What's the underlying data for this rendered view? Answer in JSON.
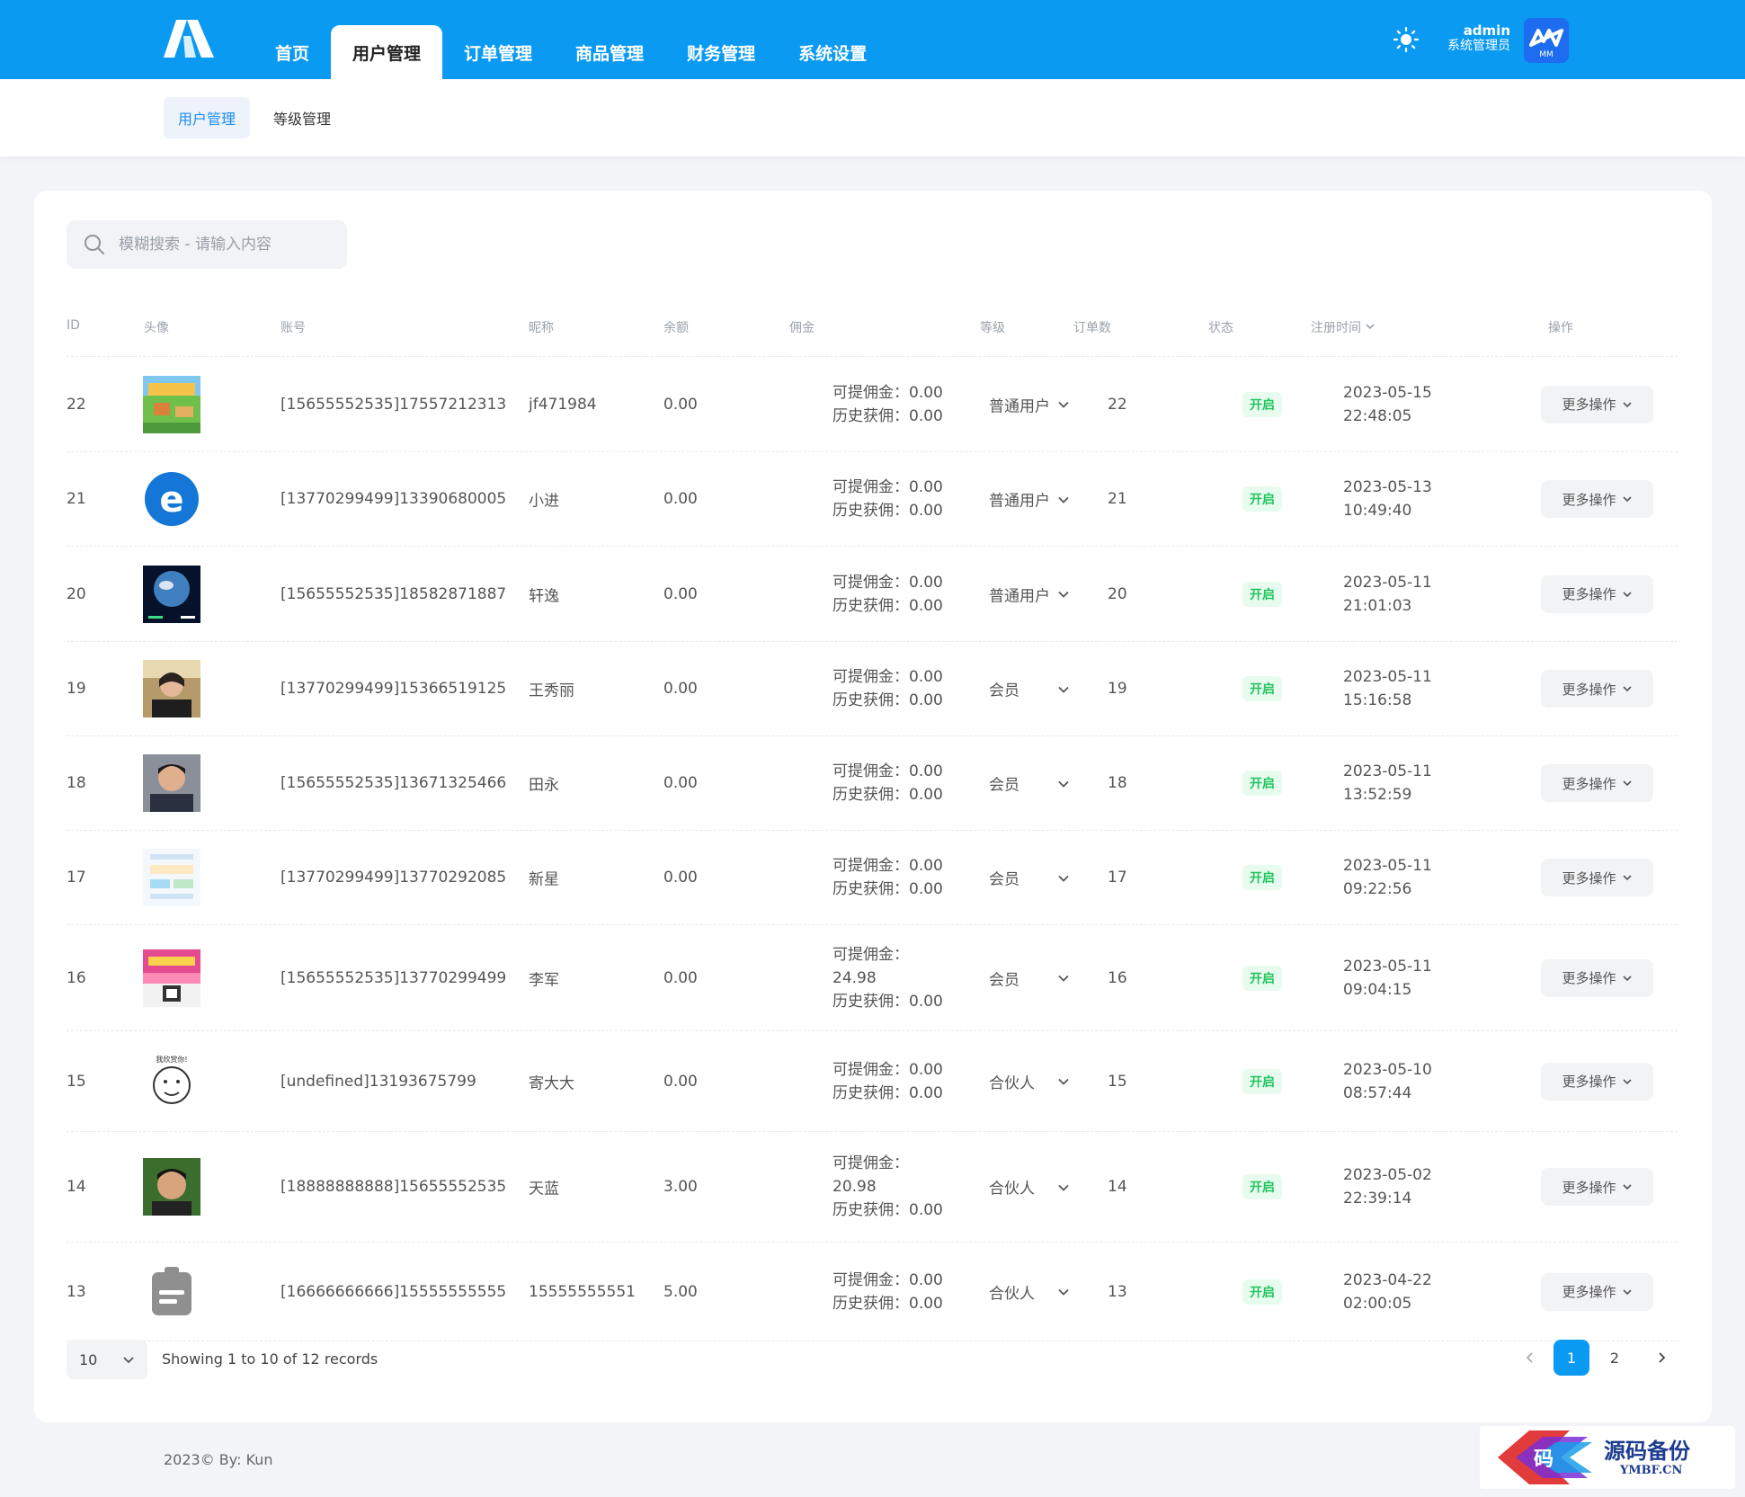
{
  "brand": {
    "accent": "#0b9af2",
    "avatar_label": "MM"
  },
  "nav": [
    {
      "label": "首页",
      "active": false
    },
    {
      "label": "用户管理",
      "active": true
    },
    {
      "label": "订单管理",
      "active": false
    },
    {
      "label": "商品管理",
      "active": false
    },
    {
      "label": "财务管理",
      "active": false
    },
    {
      "label": "系统设置",
      "active": false
    }
  ],
  "user": {
    "name": "admin",
    "role": "系统管理员"
  },
  "subnav": [
    {
      "label": "用户管理",
      "active": true
    },
    {
      "label": "等级管理",
      "active": false
    }
  ],
  "search": {
    "placeholder": "模糊搜索 - 请输入内容",
    "value": ""
  },
  "columns": [
    "ID",
    "头像",
    "账号",
    "昵称",
    "余额",
    "佣金",
    "等级",
    "订单数",
    "状态",
    "注册时间",
    "操作"
  ],
  "rows": [
    {
      "id": "22",
      "avatar": "game-thumbnail",
      "account": "[15655552535]17557212313",
      "nickname": "jf471984",
      "balance": "0.00",
      "commission_lines": [
        "可提佣金：0.00",
        "历史获佣：0.00"
      ],
      "level": "普通用户",
      "orders": "22",
      "status": "开启",
      "reg_date": "2023-05-15",
      "reg_time": "22:48:05",
      "action": "更多操作"
    },
    {
      "id": "21",
      "avatar": "telecom-logo",
      "account": "[13770299499]13390680005",
      "nickname": "小进",
      "balance": "0.00",
      "commission_lines": [
        "可提佣金：0.00",
        "历史获佣：0.00"
      ],
      "level": "普通用户",
      "orders": "21",
      "status": "开启",
      "reg_date": "2023-05-13",
      "reg_time": "10:49:40",
      "action": "更多操作"
    },
    {
      "id": "20",
      "avatar": "earth-photo",
      "account": "[15655552535]18582871887",
      "nickname": "轩逸",
      "balance": "0.00",
      "commission_lines": [
        "可提佣金：0.00",
        "历史获佣：0.00"
      ],
      "level": "普通用户",
      "orders": "20",
      "status": "开启",
      "reg_date": "2023-05-11",
      "reg_time": "21:01:03",
      "action": "更多操作"
    },
    {
      "id": "19",
      "avatar": "woman-photo",
      "account": "[13770299499]15366519125",
      "nickname": "王秀丽",
      "balance": "0.00",
      "commission_lines": [
        "可提佣金：0.00",
        "历史获佣：0.00"
      ],
      "level": "会员",
      "orders": "19",
      "status": "开启",
      "reg_date": "2023-05-11",
      "reg_time": "15:16:58",
      "action": "更多操作"
    },
    {
      "id": "18",
      "avatar": "man-photo",
      "account": "[15655552535]13671325466",
      "nickname": "田永",
      "balance": "0.00",
      "commission_lines": [
        "可提佣金：0.00",
        "历史获佣：0.00"
      ],
      "level": "会员",
      "orders": "18",
      "status": "开启",
      "reg_date": "2023-05-11",
      "reg_time": "13:52:59",
      "action": "更多操作"
    },
    {
      "id": "17",
      "avatar": "screenshot-thumbnail",
      "account": "[13770299499]13770292085",
      "nickname": "新星",
      "balance": "0.00",
      "commission_lines": [
        "可提佣金：0.00",
        "历史获佣：0.00"
      ],
      "level": "会员",
      "orders": "17",
      "status": "开启",
      "reg_date": "2023-05-11",
      "reg_time": "09:22:56",
      "action": "更多操作"
    },
    {
      "id": "16",
      "avatar": "poster-thumbnail",
      "account": "[15655552535]13770299499",
      "nickname": "李军",
      "balance": "0.00",
      "commission_lines": [
        "可提佣金：",
        "24.98",
        "历史获佣：0.00"
      ],
      "level": "会员",
      "orders": "16",
      "status": "开启",
      "reg_date": "2023-05-11",
      "reg_time": "09:04:15",
      "action": "更多操作"
    },
    {
      "id": "15",
      "avatar": "meme-face",
      "account": "[undefined]13193675799",
      "nickname": "寄大大",
      "balance": "0.00",
      "commission_lines": [
        "可提佣金：0.00",
        "历史获佣：0.00"
      ],
      "level": "合伙人",
      "orders": "15",
      "status": "开启",
      "reg_date": "2023-05-10",
      "reg_time": "08:57:44",
      "action": "更多操作"
    },
    {
      "id": "14",
      "avatar": "boy-photo",
      "account": "[18888888888]15655552535",
      "nickname": "天蓝",
      "balance": "3.00",
      "commission_lines": [
        "可提佣金：",
        "20.98",
        "历史获佣：0.00"
      ],
      "level": "合伙人",
      "orders": "14",
      "status": "开启",
      "reg_date": "2023-05-02",
      "reg_time": "22:39:14",
      "action": "更多操作"
    },
    {
      "id": "13",
      "avatar": "default-avatar",
      "account": "[16666666666]15555555555",
      "nickname": "15555555551",
      "balance": "5.00",
      "commission_lines": [
        "可提佣金：0.00",
        "历史获佣：0.00"
      ],
      "level": "合伙人",
      "orders": "13",
      "status": "开启",
      "reg_date": "2023-04-22",
      "reg_time": "02:00:05",
      "action": "更多操作"
    }
  ],
  "pagination": {
    "page_size": "10",
    "summary": "Showing 1 to 10 of 12 records",
    "pages": [
      "1",
      "2"
    ],
    "current": "1"
  },
  "footer": {
    "copyright": "2023© By: Kun"
  },
  "watermark": {
    "title": "源码备份",
    "domain": "YMBF.CN",
    "glyph": "码"
  }
}
